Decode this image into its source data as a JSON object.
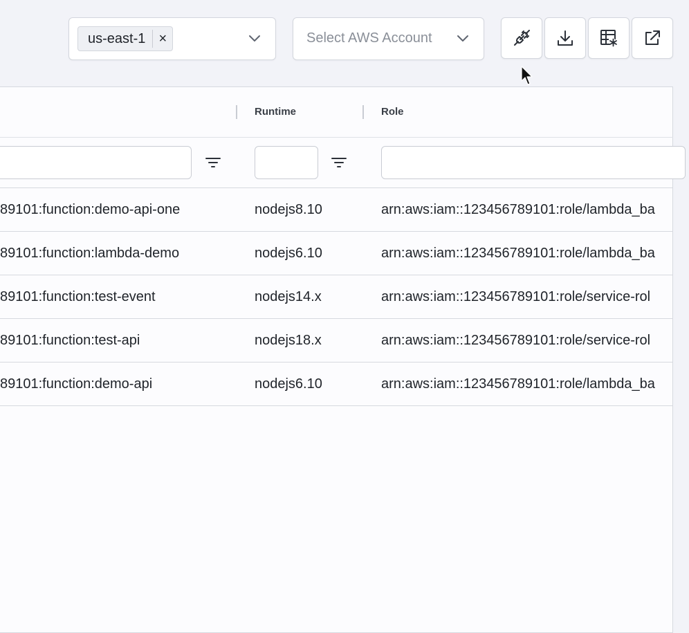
{
  "toolbar": {
    "region_chip": "us-east-1",
    "region_chip_remove": "×",
    "account_placeholder": "Select AWS Account",
    "buttons": {
      "connect": "plug-icon",
      "download": "download-icon",
      "table_settings": "table-settings-icon",
      "open_external": "external-link-icon"
    }
  },
  "table": {
    "columns": [
      {
        "key": "arn",
        "label": ""
      },
      {
        "key": "runtime",
        "label": "Runtime"
      },
      {
        "key": "role",
        "label": "Role"
      }
    ],
    "rows": [
      {
        "arn": "89101:function:demo-api-one",
        "runtime": "nodejs8.10",
        "role": "arn:aws:iam::123456789101:role/lambda_ba"
      },
      {
        "arn": "89101:function:lambda-demo",
        "runtime": "nodejs6.10",
        "role": "arn:aws:iam::123456789101:role/lambda_ba"
      },
      {
        "arn": "89101:function:test-event",
        "runtime": "nodejs14.x",
        "role": "arn:aws:iam::123456789101:role/service-rol"
      },
      {
        "arn": "89101:function:test-api",
        "runtime": "nodejs18.x",
        "role": "arn:aws:iam::123456789101:role/service-rol"
      },
      {
        "arn": "89101:function:demo-api",
        "runtime": "nodejs6.10",
        "role": "arn:aws:iam::123456789101:role/lambda_ba"
      }
    ]
  },
  "colors": {
    "background": "#f2f3f8",
    "panel": "#fcfcfe",
    "border": "#d6d9df",
    "placeholder_text": "#8a8f98"
  }
}
